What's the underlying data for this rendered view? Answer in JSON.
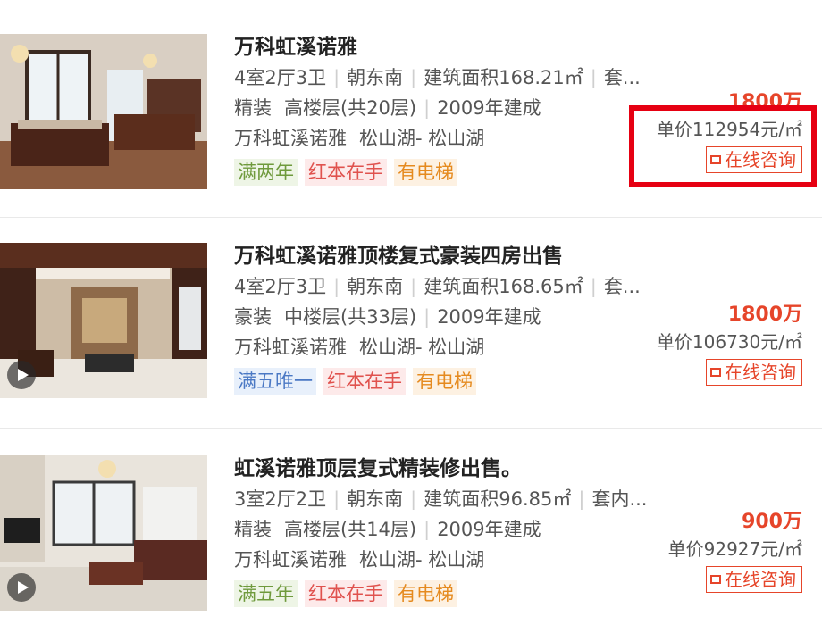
{
  "listings": [
    {
      "title": "万科虹溪诺雅",
      "layout": "4室2厅3卫",
      "orientation": "朝东南",
      "area": "建筑面积168.21㎡",
      "extra": "套...",
      "decoration": "精装",
      "floor": "高楼层(共20层)",
      "year": "2009年建成",
      "community": "万科虹溪诺雅",
      "district": "松山湖- 松山湖",
      "tags": [
        "满两年",
        "红本在手",
        "有电梯"
      ],
      "total_price": "1800万",
      "unit_price": "单价112954元/㎡",
      "consult": "在线咨询",
      "has_video": false
    },
    {
      "title": "万科虹溪诺雅顶楼复式豪装四房出售",
      "layout": "4室2厅3卫",
      "orientation": "朝东南",
      "area": "建筑面积168.65㎡",
      "extra": "套...",
      "decoration": "豪装",
      "floor": "中楼层(共33层)",
      "year": "2009年建成",
      "community": "万科虹溪诺雅",
      "district": "松山湖- 松山湖",
      "tags": [
        "满五唯一",
        "红本在手",
        "有电梯"
      ],
      "total_price": "1800万",
      "unit_price": "单价106730元/㎡",
      "consult": "在线咨询",
      "has_video": true
    },
    {
      "title": "虹溪诺雅顶层复式精装修出售。",
      "layout": "3室2厅2卫",
      "orientation": "朝东南",
      "area": "建筑面积96.85㎡",
      "extra": "套内...",
      "decoration": "精装",
      "floor": "高楼层(共14层)",
      "year": "2009年建成",
      "community": "万科虹溪诺雅",
      "district": "松山湖- 松山湖",
      "tags": [
        "满五年",
        "红本在手",
        "有电梯"
      ],
      "total_price": "900万",
      "unit_price": "单价92927元/㎡",
      "consult": "在线咨询",
      "has_video": true
    }
  ],
  "colors": {
    "price_red": "#e6452a",
    "highlight_red": "#e60012",
    "tag_green_bg": "#eef5e6",
    "tag_green_text": "#6f9a3c",
    "tag_blue_bg": "#e8f0fb",
    "tag_blue_text": "#4a78c4",
    "tag_red_bg": "#fdeaea",
    "tag_red_text": "#e0524e",
    "tag_orange_bg": "#fdf1e2",
    "tag_orange_text": "#e58a1f"
  },
  "icons": {
    "consult": "chat-icon",
    "video": "play-icon"
  }
}
